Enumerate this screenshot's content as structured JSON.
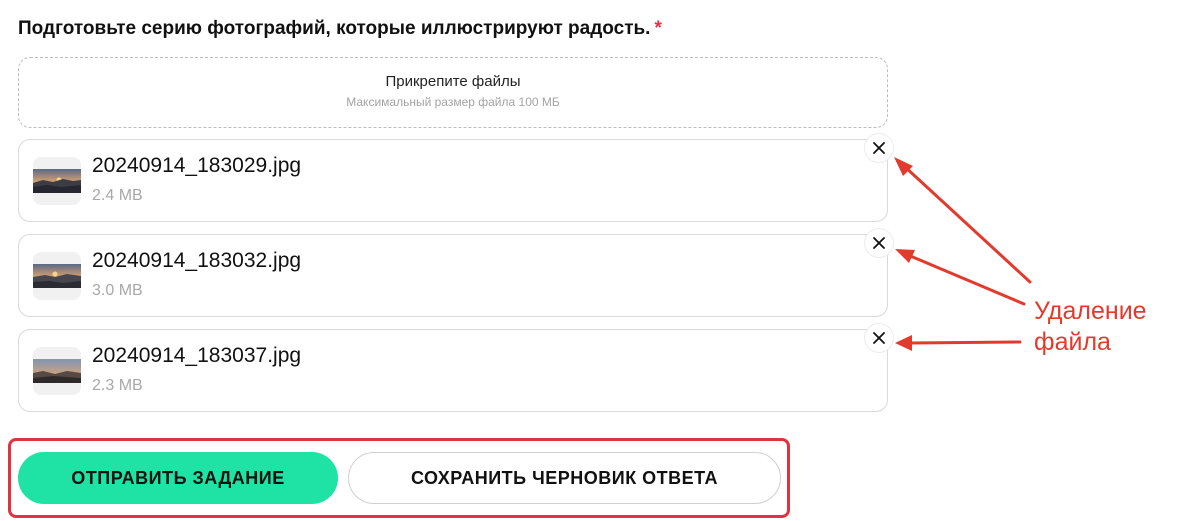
{
  "question": {
    "text": "Подготовьте серию фотографий, которые иллюстрируют радость.",
    "required_mark": "*"
  },
  "upload": {
    "title": "Прикрепите файлы",
    "hint": "Максимальный размер файла 100 МБ"
  },
  "files": [
    {
      "name": "20240914_183029.jpg",
      "size": "2.4 MB"
    },
    {
      "name": "20240914_183032.jpg",
      "size": "3.0 MB"
    },
    {
      "name": "20240914_183037.jpg",
      "size": "2.3 MB"
    }
  ],
  "annotation": {
    "line1": "Удаление",
    "line2": "файла",
    "color": "#e23b2e"
  },
  "actions": {
    "submit_label": "ОТПРАВИТЬ ЗАДАНИЕ",
    "save_draft_label": "СОХРАНИТЬ ЧЕРНОВИК ОТВЕТА"
  },
  "colors": {
    "primary": "#1ee3a4",
    "required": "#e0304a",
    "highlight": "#e0333f"
  }
}
